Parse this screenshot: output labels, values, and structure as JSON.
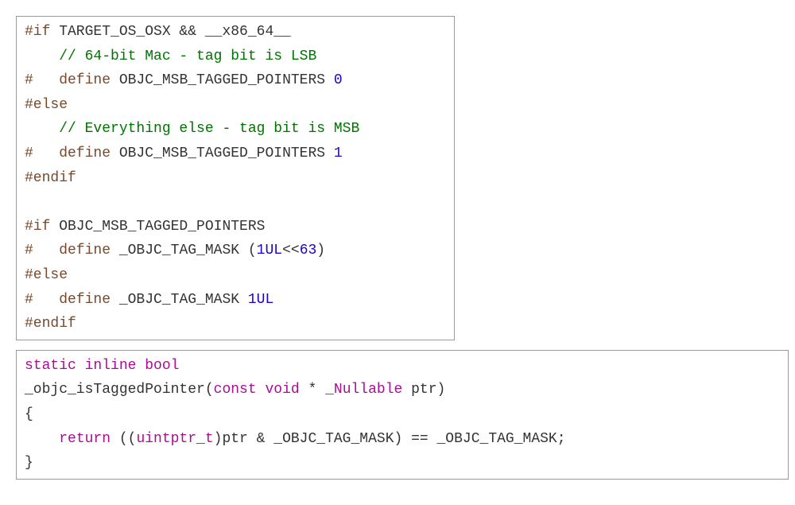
{
  "block1": {
    "l1_a": "#if",
    "l1_b": " TARGET_OS_OSX && __x86_64__",
    "l2_comment": "    // 64-bit Mac - tag bit is LSB",
    "l3_a": "#   define",
    "l3_b": " OBJC_MSB_TAGGED_POINTERS ",
    "l3_num": "0",
    "l4": "#else",
    "l5_comment": "    // Everything else - tag bit is MSB",
    "l6_a": "#   define",
    "l6_b": " OBJC_MSB_TAGGED_POINTERS ",
    "l6_num": "1",
    "l7": "#endif",
    "l8": "",
    "l9_a": "#if",
    "l9_b": " OBJC_MSB_TAGGED_POINTERS",
    "l10_a": "#   define",
    "l10_b": " _OBJC_TAG_MASK (",
    "l10_num1": "1UL",
    "l10_c": "<<",
    "l10_num2": "63",
    "l10_d": ")",
    "l11": "#else",
    "l12_a": "#   define",
    "l12_b": " _OBJC_TAG_MASK ",
    "l12_num": "1UL",
    "l13": "#endif"
  },
  "block2": {
    "l1_kw": "static inline bool",
    "l2_a": "_objc_isTaggedPointer(",
    "l2_kw1": "const",
    "l2_sp1": " ",
    "l2_kw2": "void",
    "l2_b": " * ",
    "l2_kw3": "_Nullable",
    "l2_c": " ptr)",
    "l3": "{",
    "l4_a": "    ",
    "l4_kw": "return",
    "l4_b": " ((",
    "l4_type": "uintptr_t",
    "l4_c": ")ptr & _OBJC_TAG_MASK) == _OBJC_TAG_MASK;",
    "l5": "}"
  }
}
